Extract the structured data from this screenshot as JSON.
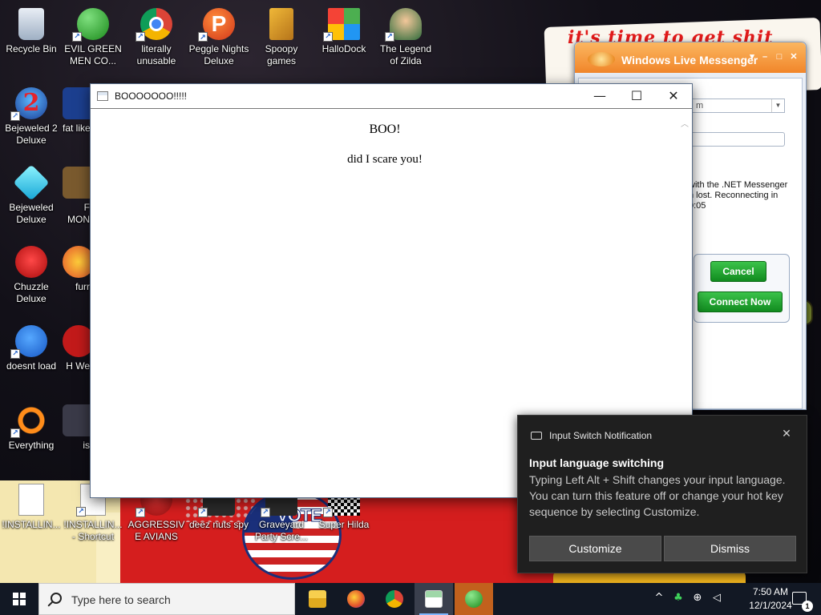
{
  "desktop": {
    "icons": [
      {
        "label": "Recycle Bin",
        "icon": "recycle-bin-icon"
      },
      {
        "label": "EVIL GREEN MEN CO...",
        "icon": "msn-men-icon"
      },
      {
        "label": "literally unusable",
        "icon": "chrome-icon"
      },
      {
        "label": "Peggle Nights Deluxe",
        "icon": "peggle-icon"
      },
      {
        "label": "Spoopy games",
        "icon": "folder-icon"
      },
      {
        "label": "HalloDock",
        "icon": "windows-logo-icon"
      },
      {
        "label": "The Legend of Zilda",
        "icon": "zilda-icon"
      },
      {
        "label": "Bejeweled 2 Deluxe",
        "icon": "bejeweled2-icon"
      },
      {
        "label": "fat like",
        "icon": "app-icon"
      },
      {
        "label": "Bejeweled Deluxe",
        "icon": "diamond-icon"
      },
      {
        "label": "F MON",
        "icon": "app-icon"
      },
      {
        "label": "Chuzzle Deluxe",
        "icon": "chuzzle-icon"
      },
      {
        "label": "furr",
        "icon": "firefox-icon"
      },
      {
        "label": "doesnt load",
        "icon": "thunderbird-icon"
      },
      {
        "label": "H We",
        "icon": "app-icon"
      },
      {
        "label": "Everything",
        "icon": "everything-search-icon"
      },
      {
        "label": "is",
        "icon": "app-icon"
      },
      {
        "label": "!INSTALLIN...",
        "icon": "document-icon"
      },
      {
        "label": "!INSTALLIN... - Shortcut",
        "icon": "document-icon"
      },
      {
        "label": "AGGRESSIVE AVIANS",
        "icon": "angry-bird-icon"
      },
      {
        "label": "deez nuts spy",
        "icon": "app-icon"
      },
      {
        "label": "Graveyard Party Scre...",
        "icon": "app-icon"
      },
      {
        "label": "Super Hilda",
        "icon": "qr-icon"
      }
    ]
  },
  "wallpaper": {
    "scrawl": "it's time to get shit",
    "vote_text": "VOTE"
  },
  "msn": {
    "title": "Windows Live Messenger",
    "combo_value": "m",
    "message": "with the .NET Messenger n lost. Reconnecting in 0:05",
    "cancel_label": "Cancel",
    "connect_label": "Connect Now"
  },
  "boo_window": {
    "title": "BOOOOOOO!!!!!",
    "heading": "BOO!",
    "text": "did I scare you!",
    "minimize_glyph": "—",
    "maximize_glyph": "☐",
    "close_glyph": "✕"
  },
  "toast": {
    "app_name": "Input Switch Notification",
    "title": "Input language switching",
    "body": "Typing Left Alt + Shift changes your input language. You can turn this feature off or change your hot key sequence by selecting Customize.",
    "customize_label": "Customize",
    "dismiss_label": "Dismiss",
    "close_glyph": "✕"
  },
  "taskbar": {
    "search_placeholder": "Type here to search",
    "apps": [
      "file-explorer-icon",
      "firefox-icon",
      "chrome-icon",
      "boo-window-icon",
      "msn-messenger-icon"
    ],
    "tray": {
      "chevron": "^",
      "network_glyph": "⊕",
      "volume_glyph": "◁",
      "time": "7:50 AM",
      "date": "12/1/2024",
      "notification_count": "1"
    }
  },
  "colors": {
    "accent_orange": "#f1862a",
    "msn_green": "#118b1f",
    "toast_bg": "#1f1f1f",
    "taskbar_bg": "#121824"
  }
}
